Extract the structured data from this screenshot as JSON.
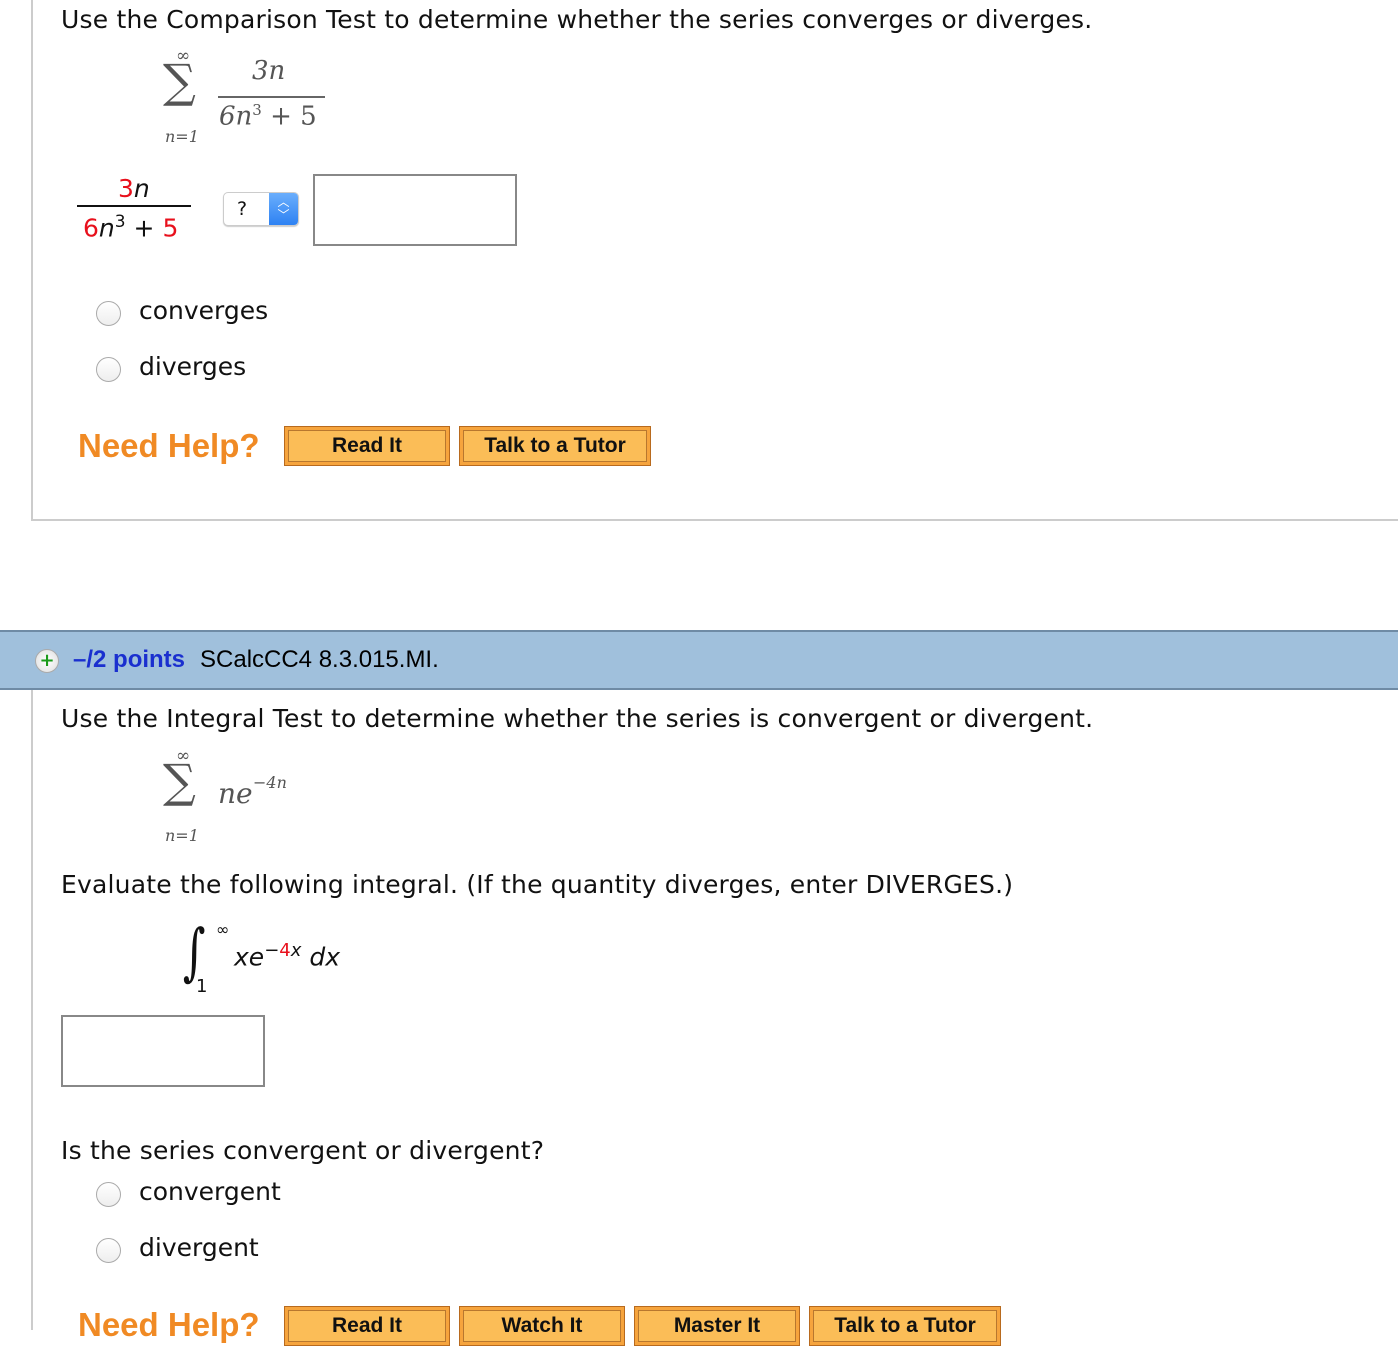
{
  "q1": {
    "prompt": "Use the Comparison Test to determine whether the series converges or diverges.",
    "sum": {
      "upper": "∞",
      "lower": "n=1",
      "numerator": "3n",
      "denominator_base": "6n",
      "denominator_exp": "3",
      "denominator_rest": " + 5"
    },
    "fraction": {
      "num_coef": "3",
      "num_var": "n",
      "den_coef": "6",
      "den_var": "n",
      "den_exp": "3",
      "den_plus": " + ",
      "den_const": "5"
    },
    "select_value": "?",
    "answer_value": "",
    "options": [
      "converges",
      "diverges"
    ],
    "need_help": "Need Help?",
    "buttons": [
      "Read It",
      "Talk to a Tutor"
    ]
  },
  "q2": {
    "points": "–/2 points",
    "code": "SCalcCC4 8.3.015.MI.",
    "prompt": "Use the Integral Test to determine whether the series is convergent or divergent.",
    "sum": {
      "upper": "∞",
      "lower": "n=1",
      "term": "ne",
      "exp": "−4n"
    },
    "evaluate": "Evaluate the following integral. (If the quantity diverges, enter DIVERGES.)",
    "integral": {
      "upper": "∞",
      "lower": "1",
      "base": "xe",
      "exp_sign": "−",
      "exp_coef": "4",
      "exp_var": "x",
      "dx": "dx"
    },
    "answer_value": "",
    "question": "Is the series convergent or divergent?",
    "options": [
      "convergent",
      "divergent"
    ],
    "need_help": "Need Help?",
    "buttons": [
      "Read It",
      "Watch It",
      "Master It",
      "Talk to a Tutor"
    ]
  },
  "colors": {
    "header_bg": "#a0c0dc",
    "points": "#1a2fcf",
    "help": "#f08a24",
    "button": "#fbbd57",
    "highlight": "#e8101c"
  }
}
